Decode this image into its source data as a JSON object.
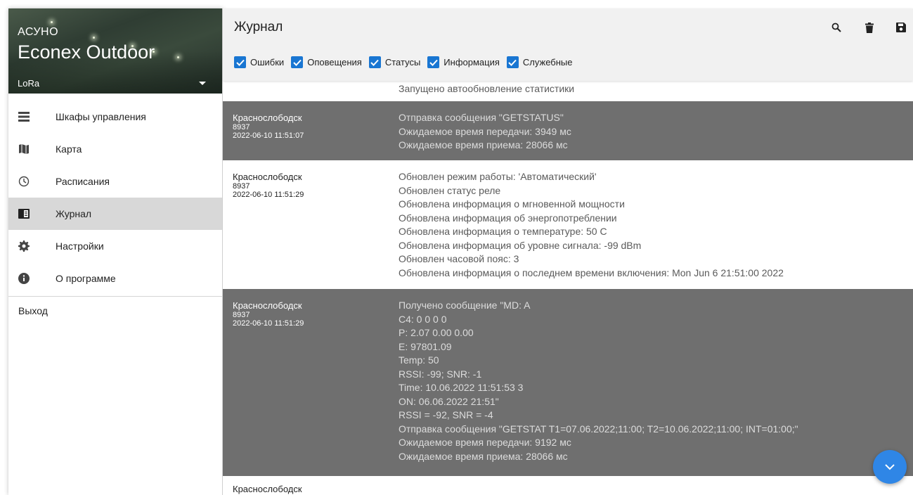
{
  "brand": {
    "subtitle": "АСУНО",
    "title": "Econex Outdoor",
    "network": "LoRa"
  },
  "nav": {
    "items": [
      {
        "label": "Шкафы управления",
        "icon": "list-icon"
      },
      {
        "label": "Карта",
        "icon": "map-icon"
      },
      {
        "label": "Расписания",
        "icon": "clock-icon"
      },
      {
        "label": "Журнал",
        "icon": "journal-icon",
        "active": true
      },
      {
        "label": "Настройки",
        "icon": "gear-icon"
      },
      {
        "label": "О программе",
        "icon": "info-icon"
      }
    ],
    "logout": "Выход"
  },
  "header": {
    "title": "Журнал",
    "filters": [
      {
        "label": "Ошибки",
        "checked": true
      },
      {
        "label": "Оповещения",
        "checked": true
      },
      {
        "label": "Статусы",
        "checked": true
      },
      {
        "label": "Информация",
        "checked": true
      },
      {
        "label": "Служебные",
        "checked": true
      }
    ],
    "actions": [
      "search-icon",
      "delete-icon",
      "save-icon"
    ]
  },
  "log": {
    "top_partial": "Запущено автообновление статистики",
    "entries": [
      {
        "city": "Краснослободск",
        "id": "8937",
        "time": "2022-06-10 11:51:07",
        "lines": [
          "Отправка сообщения \"GETSTATUS\"",
          "Ожидаемое время передачи: 3949 мс",
          "Ожидаемое время приема: 28066 мс"
        ]
      },
      {
        "city": "Краснослободск",
        "id": "8937",
        "time": "2022-06-10 11:51:29",
        "lines": [
          "Обновлен режим работы: 'Автоматический'",
          "Обновлен статус реле",
          "Обновлена информация о мгновенной мощности",
          "Обновлена информация об энергопотреблении",
          "Обновлена информация о температуре: 50 C",
          "Обновлена информация об уровне сигнала: -99 dBm",
          "Обновлен часовой пояс: 3",
          "Обновлена информация о последнем времени включения: Mon Jun 6 21:51:00 2022"
        ]
      },
      {
        "city": "Краснослободск",
        "id": "8937",
        "time": "2022-06-10 11:51:29",
        "lines": [
          "Получено сообщение \"MD: A",
          "C4: 0 0 0 0",
          "P: 2.07 0.00 0.00",
          "E: 97801.09",
          "Temp: 50",
          "RSSI: -99; SNR: -1",
          "Time: 10.06.2022 11:51:53 3",
          "ON: 06.06.2022 21:51\"",
          "RSSI = -92, SNR = -4",
          "Отправка сообщения \"GETSTAT T1=07.06.2022;11:00; T2=10.06.2022;11:00; INT=01:00;\"",
          "Ожидаемое время передачи: 9192 мс",
          "Ожидаемое время приема: 28066 мс"
        ]
      },
      {
        "city": "Краснослободск",
        "id": "",
        "time": "",
        "lines": []
      }
    ]
  },
  "colors": {
    "accent": "#1976d2",
    "fab": "#2f86e6",
    "dark_row": "#6f6f6f",
    "active_nav": "#d8d8d8"
  }
}
